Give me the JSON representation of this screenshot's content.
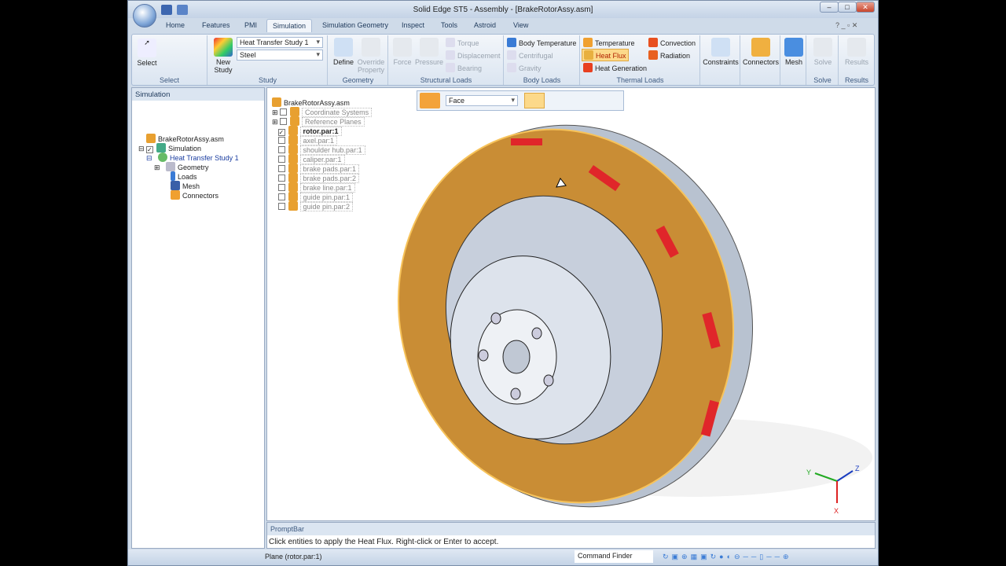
{
  "window": {
    "title": "Solid Edge ST5 - Assembly - [BrakeRotorAssy.asm]",
    "min": "–",
    "max": "□",
    "close": "✕"
  },
  "tabs": [
    "Home",
    "Features",
    "PMI",
    "Simulation",
    "Simulation Geometry",
    "Inspect",
    "Tools",
    "Astroid",
    "View"
  ],
  "ribbon": {
    "select": {
      "label": "Select",
      "group": "Select"
    },
    "study": {
      "new": "New Study",
      "study_value": "Heat Transfer Study 1",
      "material_value": "Steel",
      "group": "Study"
    },
    "geometry": {
      "define": "Define",
      "override": "Override Property",
      "group": "Geometry"
    },
    "structural": {
      "force": "Force",
      "pressure": "Pressure",
      "torque": "Torque",
      "displacement": "Displacement",
      "bearing": "Bearing",
      "group": "Structural Loads"
    },
    "body": {
      "temp": "Body Temperature",
      "centrifugal": "Centrifugal",
      "gravity": "Gravity",
      "group": "Body Loads"
    },
    "thermal": {
      "temperature": "Temperature",
      "heat_flux": "Heat Flux",
      "heat_generation": "Heat Generation",
      "convection": "Convection",
      "radiation": "Radiation",
      "group": "Thermal Loads"
    },
    "constraints": "Constraints",
    "connectors": "Connectors",
    "mesh": "Mesh",
    "solve": "Solve",
    "solve_group": "Solve",
    "results": "Results",
    "results_group": "Results"
  },
  "left_panel": {
    "title": "Simulation",
    "tree": [
      "BrakeRotorAssy.asm",
      "Simulation",
      "Heat Transfer Study 1",
      "Geometry",
      "Loads",
      "Mesh",
      "Connectors"
    ]
  },
  "assembly_tree": {
    "root": "BrakeRotorAssy.asm",
    "items": [
      "Coordinate Systems",
      "Reference Planes",
      "rotor.par:1",
      "axel.par:1",
      "shoulder hub.par:1",
      "caliper.par:1",
      "brake pads.par:1",
      "brake pads.par:2",
      "brake line.par:1",
      "guide pin.par:1",
      "guide pin.par:2"
    ]
  },
  "selection_bar": {
    "filter": "Face"
  },
  "prompt_bar": {
    "title": "PromptBar",
    "message": "Click entities to apply the Heat Flux. Right-click or Enter to accept."
  },
  "status": {
    "text": "Plane (rotor.par:1)",
    "command_finder": "Command Finder"
  },
  "axes": {
    "x": "X",
    "y": "Y",
    "z": "Z"
  },
  "colors": {
    "accent": "#f7c35a",
    "rotor_face": "#c98d35",
    "vent": "#e0262a"
  }
}
